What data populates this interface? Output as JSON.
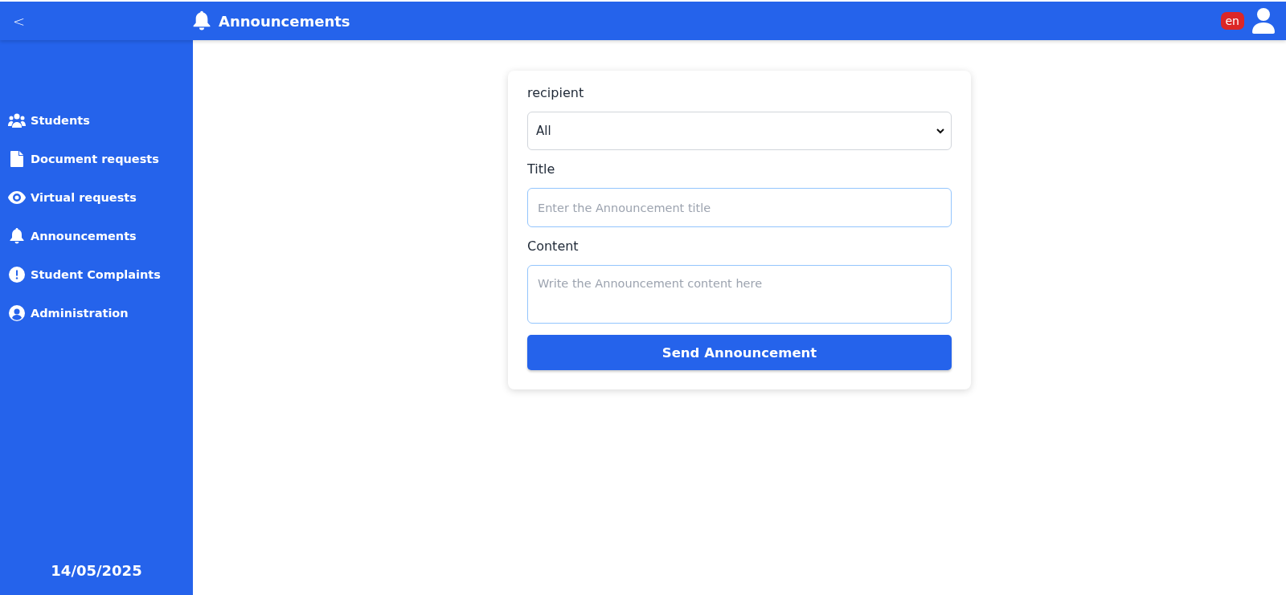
{
  "header": {
    "back": "<",
    "title": "Announcements",
    "language": "en"
  },
  "sidebar": {
    "items": [
      {
        "kind": "people",
        "label": "Students"
      },
      {
        "kind": "file",
        "label": "Document requests"
      },
      {
        "kind": "eye",
        "label": "Virtual requests"
      },
      {
        "kind": "bell",
        "label": "Announcements"
      },
      {
        "kind": "alert",
        "label": "Student Complaints"
      },
      {
        "kind": "user",
        "label": "Administration"
      }
    ],
    "date": "14/05/2025"
  },
  "form": {
    "recipient_label": "recipient",
    "recipient_value": "All",
    "title_label": "Title",
    "title_placeholder": "Enter the Announcement title",
    "content_label": "Content",
    "content_placeholder": "Write the Announcement content here",
    "submit": "Send Announcement"
  }
}
